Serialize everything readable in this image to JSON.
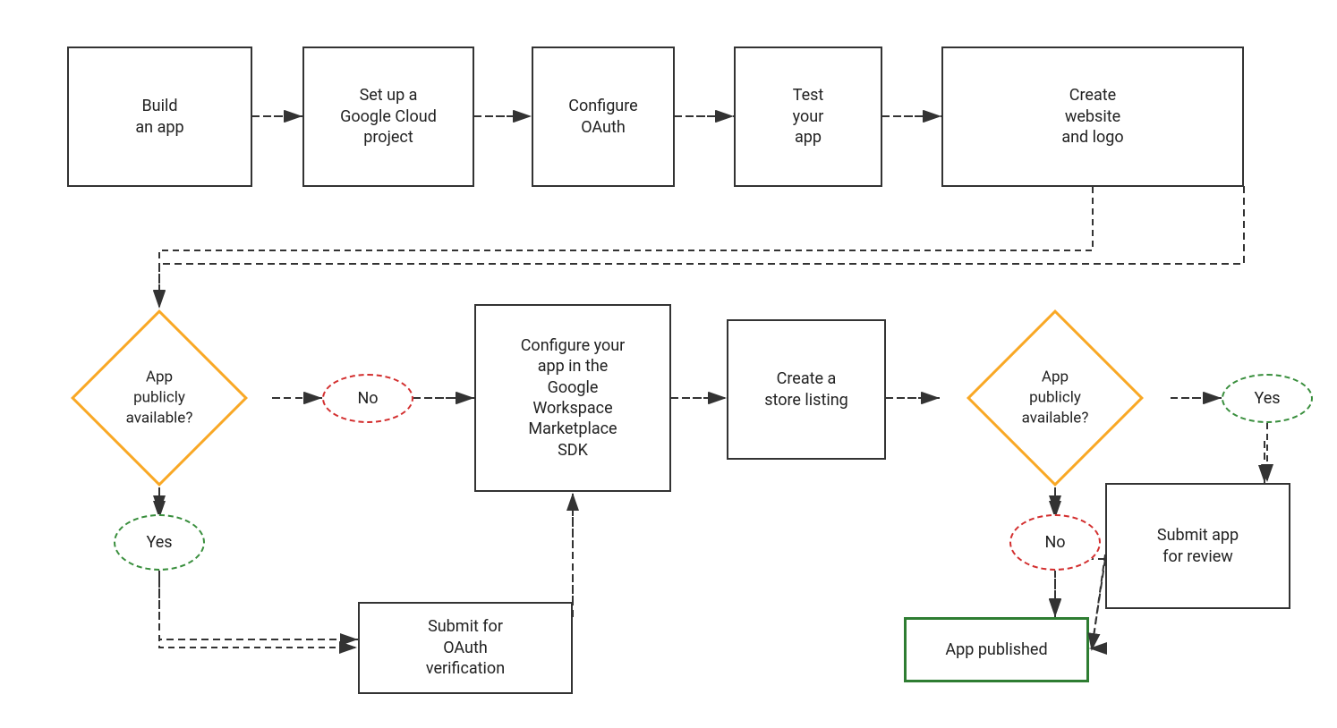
{
  "boxes": {
    "build_app": {
      "label": "Build\nan app"
    },
    "setup_gcp": {
      "label": "Set up a\nGoogle Cloud\nproject"
    },
    "configure_oauth": {
      "label": "Configure\nOAuth"
    },
    "test_app": {
      "label": "Test\nyour\napp"
    },
    "create_website": {
      "label": "Create\nwebsite\nand logo"
    },
    "configure_marketplace": {
      "label": "Configure your\napp in the\nGoogle\nWorkspace\nMarketplace\nSDK"
    },
    "create_store": {
      "label": "Create a\nstore listing"
    },
    "submit_oauth": {
      "label": "Submit for\nOAuth\nverification"
    },
    "submit_review": {
      "label": "Submit app\nfor review"
    },
    "app_published": {
      "label": "App published"
    }
  },
  "diamonds": {
    "app_public_left": {
      "label": "App\npublicly\navailable?"
    },
    "app_public_right": {
      "label": "App\npublicly\navailable?"
    }
  },
  "ovals": {
    "no_left": {
      "label": "No"
    },
    "yes_left": {
      "label": "Yes"
    },
    "no_right": {
      "label": "No"
    },
    "yes_right": {
      "label": "Yes"
    }
  }
}
